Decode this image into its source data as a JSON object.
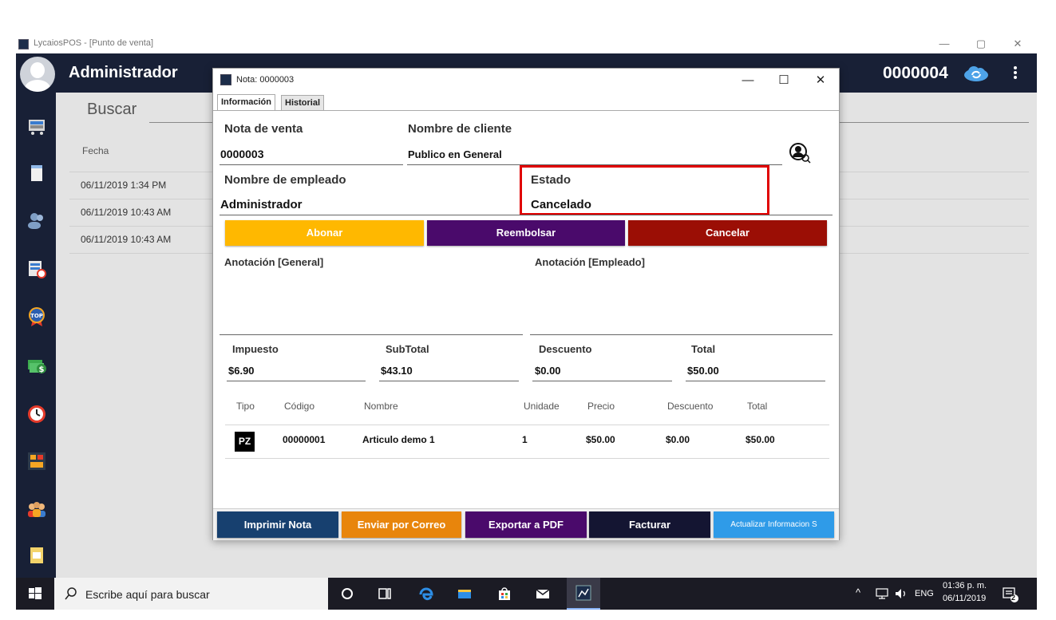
{
  "window": {
    "title": "LycaiosPOS - [Punto de venta]",
    "minimize": "—",
    "maximize": "▢",
    "close": "✕"
  },
  "header": {
    "user": "Administrador",
    "number": "0000004"
  },
  "main": {
    "search_label": "Buscar",
    "column_fecha": "Fecha",
    "rows": [
      "06/11/2019 1:34 PM",
      "06/11/2019 10:43 AM",
      "06/11/2019 10:43 AM"
    ]
  },
  "modal": {
    "title": "Nota: 0000003",
    "minimize": "—",
    "maximize": "☐",
    "close": "✕",
    "tabs": [
      "Información",
      "Historial"
    ],
    "fields": {
      "nota_label": "Nota de venta",
      "nota_value": "0000003",
      "cliente_label": "Nombre de cliente",
      "cliente_value": "Publico en General",
      "empleado_label": "Nombre de empleado",
      "empleado_value": "Administrador",
      "estado_label": "Estado",
      "estado_value": "Cancelado"
    },
    "actions": {
      "abonar": "Abonar",
      "reembolsar": "Reembolsar",
      "cancelar": "Cancelar"
    },
    "annotations": {
      "general": "Anotación [General]",
      "empleado": "Anotación [Empleado]"
    },
    "totals": {
      "impuesto_label": "Impuesto",
      "impuesto_value": "$6.90",
      "subtotal_label": "SubTotal",
      "subtotal_value": "$43.10",
      "descuento_label": "Descuento",
      "descuento_value": "$0.00",
      "total_label": "Total",
      "total_value": "$50.00"
    },
    "table": {
      "headers": [
        "Tipo",
        "Código",
        "Nombre",
        "Unidade",
        "Precio",
        "Descuento",
        "Total"
      ],
      "rows": [
        {
          "tipo": "PZ",
          "codigo": "00000001",
          "nombre": "Articulo demo 1",
          "unidades": "1",
          "precio": "$50.00",
          "descuento": "$0.00",
          "total": "$50.00"
        }
      ]
    },
    "bottom_buttons": {
      "imprimir": "Imprimir Nota",
      "correo": "Enviar por Correo",
      "pdf": "Exportar a PDF",
      "facturar": "Facturar",
      "actualizar": "Actualizar Informacion S"
    }
  },
  "taskbar": {
    "search_placeholder": "Escribe aquí para buscar",
    "language": "ENG",
    "time": "01:36 p. m.",
    "date": "06/11/2019",
    "notifications": "2"
  },
  "colors": {
    "header_bg": "#182036",
    "abonar": "#ffb800",
    "reembolsar": "#4a0a6b",
    "cancelar": "#9b0e05",
    "imprimir": "#17406f",
    "correo": "#e8850c",
    "pdf": "#4a0a6b",
    "facturar": "#141532",
    "actualizar": "#2f9be8",
    "highlight": "#e00000"
  }
}
